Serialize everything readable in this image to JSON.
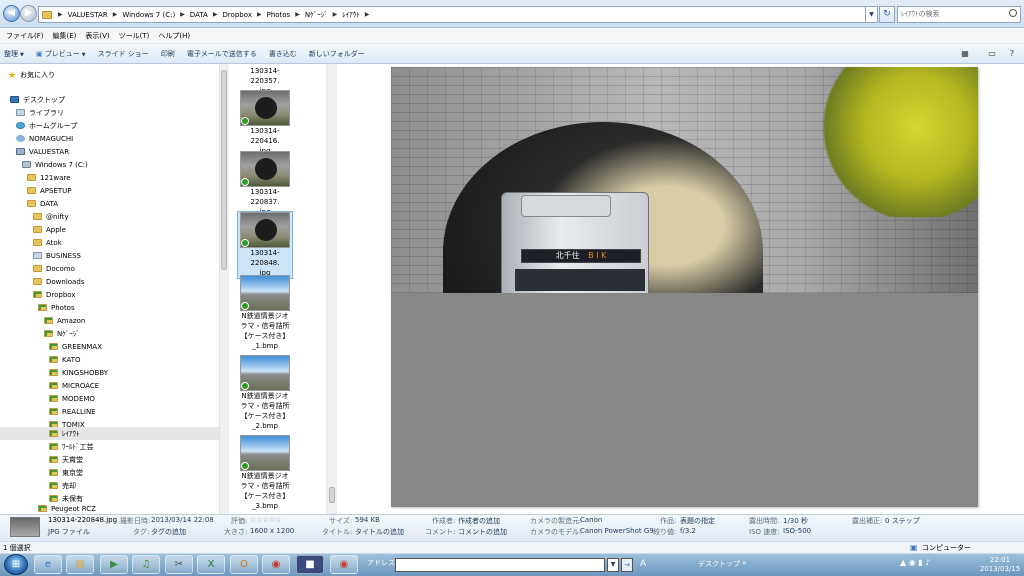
{
  "address": {
    "crumbs": [
      "VALUESTAR",
      "Windows 7 (C:)",
      "DATA",
      "Dropbox",
      "Photos",
      "Nｹﾞｰｼﾞ",
      "ﾚｲｱｳﾄ"
    ],
    "search_placeholder": "ﾚｲｱｳﾄの検索"
  },
  "menubar": [
    "ファイル(F)",
    "編集(E)",
    "表示(V)",
    "ツール(T)",
    "ヘルプ(H)"
  ],
  "commandbar": {
    "organize": "整理",
    "preview": "プレビュー",
    "slideshow": "スライド ショー",
    "print": "印刷",
    "email": "電子メールで送信する",
    "burn": "書き込む",
    "new_folder": "新しいフォルダー"
  },
  "nav_tree": [
    {
      "label": "お気に入り",
      "icon": "star"
    },
    {
      "label": "デスクトップ",
      "icon": "desk"
    },
    {
      "label": "ライブラリ",
      "icon": "lib"
    },
    {
      "label": "ホームグループ",
      "icon": "hg"
    },
    {
      "label": "NOMAGUCHI",
      "icon": "usr"
    },
    {
      "label": "VALUESTAR",
      "icon": "pc"
    },
    {
      "label": "Windows 7 (C:)",
      "icon": "drv"
    },
    {
      "label": "121ware",
      "icon": "f"
    },
    {
      "label": "APSETUP",
      "icon": "f"
    },
    {
      "label": "DATA",
      "icon": "f"
    },
    {
      "label": "@nifty",
      "icon": "f"
    },
    {
      "label": "Apple",
      "icon": "f"
    },
    {
      "label": "Atok",
      "icon": "f"
    },
    {
      "label": "BUSINESS",
      "icon": "lib"
    },
    {
      "label": "Docomo",
      "icon": "f"
    },
    {
      "label": "Downloads",
      "icon": "f"
    },
    {
      "label": "Dropbox",
      "icon": "fc"
    },
    {
      "label": "Photos",
      "icon": "fc"
    },
    {
      "label": "Amazon",
      "icon": "fc"
    },
    {
      "label": "Nｹﾞｰｼﾞ",
      "icon": "fc"
    },
    {
      "label": "GREENMAX",
      "icon": "fc"
    },
    {
      "label": "KATO",
      "icon": "fc"
    },
    {
      "label": "KINGSHOBBY",
      "icon": "fc"
    },
    {
      "label": "MICROACE",
      "icon": "fc"
    },
    {
      "label": "MODEMO",
      "icon": "fc"
    },
    {
      "label": "REALLINE",
      "icon": "fc"
    },
    {
      "label": "TOMIX",
      "icon": "fc"
    },
    {
      "label": "ﾚｲｱｳﾄ",
      "icon": "fc"
    },
    {
      "label": "ﾜｰﾙﾄﾞ工芸",
      "icon": "fc"
    },
    {
      "label": "天賞堂",
      "icon": "fc"
    },
    {
      "label": "東京堂",
      "icon": "fc"
    },
    {
      "label": "売却",
      "icon": "fc"
    },
    {
      "label": "未保有",
      "icon": "fc"
    },
    {
      "label": "Peugeot RCZ",
      "icon": "fc"
    }
  ],
  "files": [
    {
      "name": "130314-220357.jpg",
      "line1": "130314-220357.",
      "line2": "jpg",
      "kind": "tun"
    },
    {
      "name": "130314-220416.jpg",
      "line1": "130314-220416.",
      "line2": "jpg",
      "kind": "tun"
    },
    {
      "name": "130314-220837.jpg",
      "line1": "130314-220837.",
      "line2": "jpg",
      "kind": "tun"
    },
    {
      "name": "130314-220848.jpg",
      "line1": "130314-220848.",
      "line2": "jpg",
      "kind": "tun"
    },
    {
      "name": "N鉄道情景ジオラマ・信号詰所【ケース付き】_1.bmp",
      "line1": "N鉄道情景ジオ",
      "line2": "ラマ・信号詰所",
      "line3": "【ケース付き】",
      "line4": "_1.bmp",
      "kind": "dio"
    },
    {
      "name": "N鉄道情景ジオラマ・信号詰所【ケース付き】_2.bmp",
      "line1": "N鉄道情景ジオ",
      "line2": "ラマ・信号詰所",
      "line3": "【ケース付き】",
      "line4": "_2.bmp",
      "kind": "dio"
    },
    {
      "name": "N鉄道情景ジオラマ・信号詰所【ケース付き】_3.bmp",
      "line1": "N鉄道情景ジオ",
      "line2": "ラマ・信号詰所",
      "line3": "【ケース付き】",
      "line4": "_3.bmp",
      "kind": "dio"
    }
  ],
  "preview": {
    "sign_text": "北千住",
    "sign_code": "B I K"
  },
  "details": {
    "filename": "130314-220848.jpg",
    "filetype": "JPG ファイル",
    "date_label": "撮影日時:",
    "date_value": "2013/03/14 22:08",
    "tag_label": "タグ:",
    "tag_value": "タグの追加",
    "rating_label": "評価:",
    "size_dim_label": "大きさ:",
    "size_dim_value": "1600 x 1200",
    "filesize_label": "サイズ:",
    "filesize_value": "594 KB",
    "title_label": "タイトル:",
    "title_value": "タイトルの追加",
    "author_label": "作成者:",
    "author_value": "作成者の追加",
    "comment_label": "コメント:",
    "comment_value": "コメントの追加",
    "maker_label": "カメラの製造元:",
    "maker_value": "Canon",
    "model_label": "カメラのモデル:",
    "model_value": "Canon PowerShot G9",
    "work_label": "作品:",
    "work_value": "表題の指定",
    "fstop_label": "絞り値:",
    "fstop_value": "f/3.2",
    "exposure_label": "露出時間:",
    "exposure_value": "1/30 秒",
    "iso_label": "ISO 速度:",
    "iso_value": "ISO-500",
    "bias_label": "露出補正:",
    "bias_value": "0 ステップ"
  },
  "statusbar": {
    "selected": "1 個選択",
    "location": "コンピューター"
  },
  "taskbar": {
    "address_label": "アドレス",
    "desktop_label": "デスクトップ",
    "time": "22:01",
    "date": "2013/03/15"
  }
}
